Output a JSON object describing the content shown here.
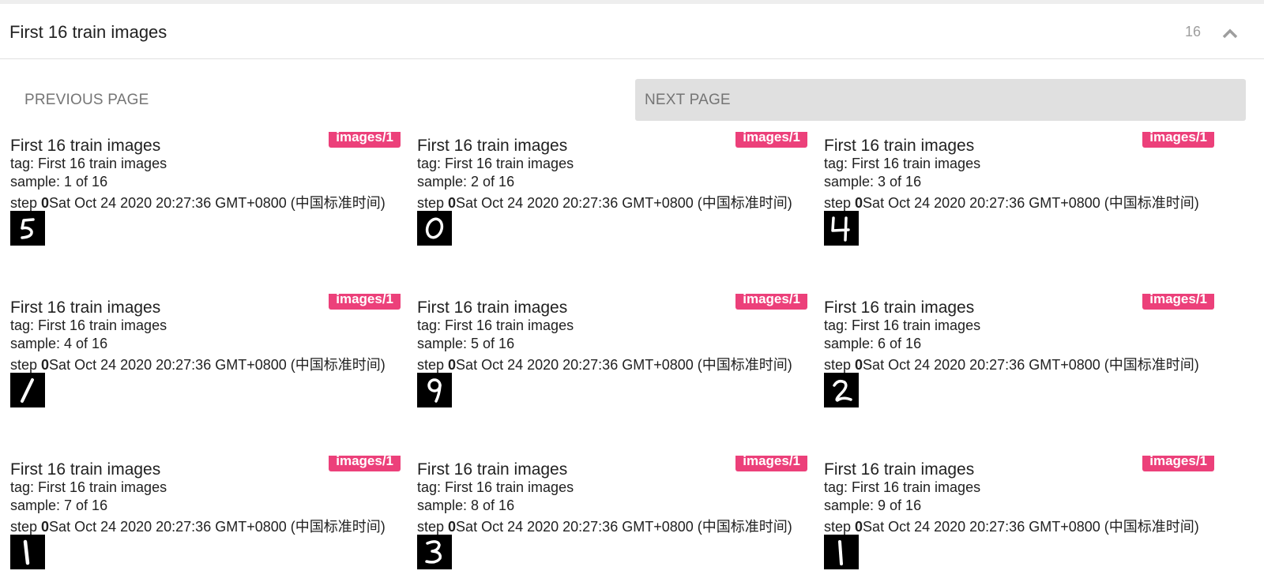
{
  "header": {
    "title": "First 16 train images",
    "count": "16",
    "collapse_icon": "chevron-up-icon"
  },
  "pager": {
    "previous_label": "PREVIOUS PAGE",
    "next_label": "NEXT PAGE"
  },
  "colors": {
    "badge": "#ec407a",
    "next_button_bg": "#e0e0e0"
  },
  "cards": [
    {
      "title": "First 16 train images",
      "badge": "images/1",
      "tag": "tag: First 16 train images",
      "sample": "sample: 1 of 16",
      "step_label": "step ",
      "step_value": "0",
      "timestamp": "Sat Oct 24 2020 20:27:36 GMT+0800 (中国标准时间)",
      "digit": "5"
    },
    {
      "title": "First 16 train images",
      "badge": "images/1",
      "tag": "tag: First 16 train images",
      "sample": "sample: 2 of 16",
      "step_label": "step ",
      "step_value": "0",
      "timestamp": "Sat Oct 24 2020 20:27:36 GMT+0800 (中国标准时间)",
      "digit": "0"
    },
    {
      "title": "First 16 train images",
      "badge": "images/1",
      "tag": "tag: First 16 train images",
      "sample": "sample: 3 of 16",
      "step_label": "step ",
      "step_value": "0",
      "timestamp": "Sat Oct 24 2020 20:27:36 GMT+0800 (中国标准时间)",
      "digit": "4"
    },
    {
      "title": "First 16 train images",
      "badge": "images/1",
      "tag": "tag: First 16 train images",
      "sample": "sample: 4 of 16",
      "step_label": "step ",
      "step_value": "0",
      "timestamp": "Sat Oct 24 2020 20:27:36 GMT+0800 (中国标准时间)",
      "digit": "1"
    },
    {
      "title": "First 16 train images",
      "badge": "images/1",
      "tag": "tag: First 16 train images",
      "sample": "sample: 5 of 16",
      "step_label": "step ",
      "step_value": "0",
      "timestamp": "Sat Oct 24 2020 20:27:36 GMT+0800 (中国标准时间)",
      "digit": "9"
    },
    {
      "title": "First 16 train images",
      "badge": "images/1",
      "tag": "tag: First 16 train images",
      "sample": "sample: 6 of 16",
      "step_label": "step ",
      "step_value": "0",
      "timestamp": "Sat Oct 24 2020 20:27:36 GMT+0800 (中国标准时间)",
      "digit": "2"
    },
    {
      "title": "First 16 train images",
      "badge": "images/1",
      "tag": "tag: First 16 train images",
      "sample": "sample: 7 of 16",
      "step_label": "step ",
      "step_value": "0",
      "timestamp": "Sat Oct 24 2020 20:27:36 GMT+0800 (中国标准时间)",
      "digit": "1"
    },
    {
      "title": "First 16 train images",
      "badge": "images/1",
      "tag": "tag: First 16 train images",
      "sample": "sample: 8 of 16",
      "step_label": "step ",
      "step_value": "0",
      "timestamp": "Sat Oct 24 2020 20:27:36 GMT+0800 (中国标准时间)",
      "digit": "3"
    },
    {
      "title": "First 16 train images",
      "badge": "images/1",
      "tag": "tag: First 16 train images",
      "sample": "sample: 9 of 16",
      "step_label": "step ",
      "step_value": "0",
      "timestamp": "Sat Oct 24 2020 20:27:36 GMT+0800 (中国标准时间)",
      "digit": "1"
    }
  ]
}
